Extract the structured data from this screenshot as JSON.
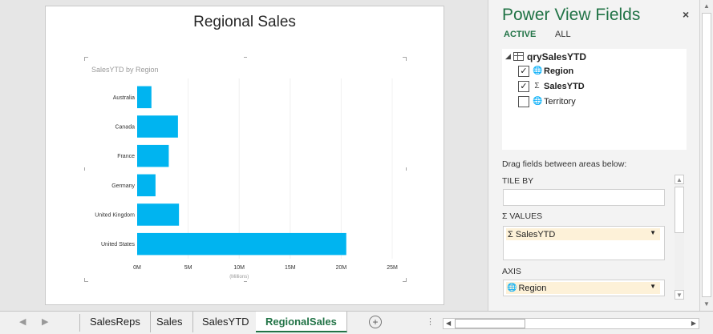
{
  "report": {
    "title": "Regional Sales",
    "chart_label": "SalesYTD by Region"
  },
  "chart_data": {
    "type": "bar",
    "orientation": "horizontal",
    "title": "SalesYTD by Region",
    "categories": [
      "Australia",
      "Canada",
      "France",
      "Germany",
      "United Kingdom",
      "United States"
    ],
    "values": [
      1.4,
      4.0,
      3.1,
      1.8,
      4.1,
      20.5
    ],
    "xlim": [
      0,
      25
    ],
    "xticks": [
      "0M",
      "5M",
      "10M",
      "15M",
      "20M",
      "25M"
    ],
    "xlabel": "(Millions)",
    "ylabel": "",
    "bar_color": "#00b4f0",
    "grid": true
  },
  "pane": {
    "title": "Power View Fields",
    "close": "×",
    "tabs": {
      "active": "ACTIVE",
      "all": "ALL"
    },
    "table_name": "qrySalesYTD",
    "fields": [
      {
        "label": "Region",
        "checked": true,
        "icon": "globe-icon",
        "bold": true
      },
      {
        "label": "SalesYTD",
        "checked": true,
        "icon": "sigma-icon",
        "bold": true
      },
      {
        "label": "Territory",
        "checked": false,
        "icon": "globe-icon",
        "bold": false
      }
    ],
    "drag_hint": "Drag fields between areas below:",
    "areas": {
      "tile_by": "TILE BY",
      "values": "VALUES",
      "values_item": "SalesYTD",
      "axis": "AXIS",
      "axis_item": "Region"
    }
  },
  "sheets": {
    "tabs": [
      "SalesReps",
      "Sales",
      "SalesYTD",
      "RegionalSales"
    ],
    "active": "RegionalSales"
  },
  "colors": {
    "accent": "#217346",
    "bar": "#00b4f0"
  }
}
